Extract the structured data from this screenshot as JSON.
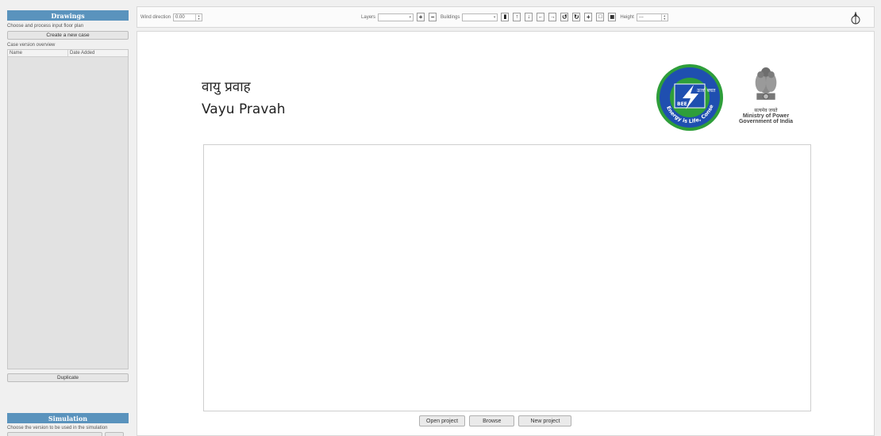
{
  "sidebar": {
    "drawings_header": "Drawings",
    "drawings_sub": "Choose and process input floor plan",
    "create_case_button": "Create a new case",
    "case_overview_label": "Case version overview",
    "table_columns": {
      "name": "Name",
      "date_added": "Date Added"
    },
    "duplicate_button": "Duplicate",
    "simulation_header": "Simulation",
    "simulation_sub": "Choose the version to be used in the simulation"
  },
  "toolbar": {
    "wind_direction_label": "Wind direction",
    "wind_direction_value": "0.00",
    "layers_label": "Layers",
    "buildings_label": "Buildings",
    "height_label": "Height",
    "height_value": "---"
  },
  "main": {
    "title_hindi": "वायु प्रवाह",
    "title_english": "Vayu Pravah",
    "bee_logo_text": "ऊर्जा बचत",
    "bee_ring_text": "Energy is Life, Conserve it",
    "bee_center_text": "BEE",
    "emblem_motto": "सत्यमेव जयते",
    "ministry_line1": "Ministry of Power",
    "ministry_line2": "Government of India",
    "buttons": {
      "open_project": "Open project",
      "browse": "Browse",
      "new_project": "New project"
    }
  },
  "colors": {
    "section_header_bg": "#5a93bd",
    "bee_green": "#2e9e3a",
    "bee_blue": "#1f4fb0"
  }
}
